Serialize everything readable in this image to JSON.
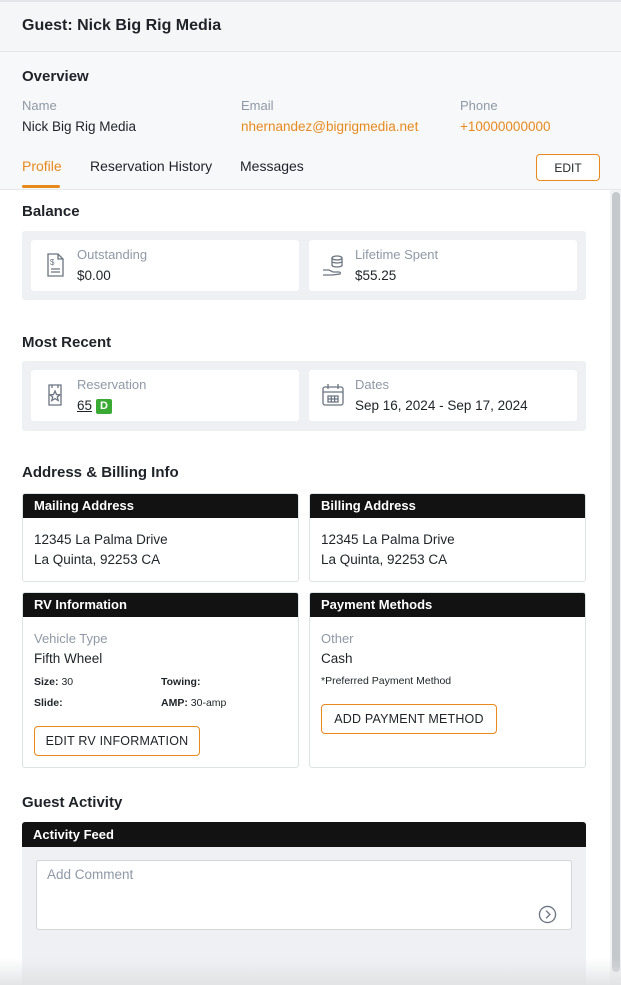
{
  "header": {
    "title": "Guest: Nick Big Rig Media"
  },
  "overview": {
    "title": "Overview",
    "name_label": "Name",
    "name_value": "Nick Big Rig Media",
    "email_label": "Email",
    "email_value": "nhernandez@bigrigmedia.net",
    "phone_label": "Phone",
    "phone_value": "+10000000000"
  },
  "tabs": [
    {
      "label": "Profile",
      "active": true
    },
    {
      "label": "Reservation History",
      "active": false
    },
    {
      "label": "Messages",
      "active": false
    }
  ],
  "edit_label": "EDIT",
  "balance": {
    "title": "Balance",
    "outstanding_label": "Outstanding",
    "outstanding_value": "$0.00",
    "lifetime_label": "Lifetime Spent",
    "lifetime_value": "$55.25"
  },
  "recent": {
    "title": "Most Recent",
    "reservation_label": "Reservation",
    "reservation_number": "65",
    "reservation_badge": "D",
    "dates_label": "Dates",
    "dates_value": "Sep 16, 2024 - Sep 17, 2024"
  },
  "address": {
    "title": "Address & Billing Info",
    "mailing": {
      "head": "Mailing Address",
      "line1": "12345 La Palma Drive",
      "line2": "La Quinta, 92253 CA"
    },
    "billing": {
      "head": "Billing Address",
      "line1": "12345 La Palma Drive",
      "line2": "La Quinta, 92253 CA"
    }
  },
  "rv": {
    "head": "RV Information",
    "vehicle_type_label": "Vehicle Type",
    "vehicle_type_value": "Fifth Wheel",
    "size_label": "Size:",
    "size_value": "30",
    "towing_label": "Towing:",
    "towing_value": "",
    "slide_label": "Slide:",
    "slide_value": "",
    "amp_label": "AMP:",
    "amp_value": "30-amp",
    "edit_button": "EDIT RV INFORMATION"
  },
  "payment": {
    "head": "Payment Methods",
    "type_label": "Other",
    "type_value": "Cash",
    "preferred_note": "*Preferred Payment Method",
    "add_button": "ADD PAYMENT METHOD"
  },
  "activity": {
    "title": "Guest Activity",
    "feed_head": "Activity Feed",
    "comment_placeholder": "Add Comment"
  },
  "icons": {
    "outstanding": "invoice-dollar-icon",
    "lifetime": "hand-coins-icon",
    "reservation": "ticket-star-icon",
    "dates": "calendar-icon",
    "send": "send-arrow-icon"
  },
  "colors": {
    "accent": "#e8891c",
    "badge": "#3aaa35",
    "box_header": "#121212",
    "muted": "#8f99a6"
  }
}
